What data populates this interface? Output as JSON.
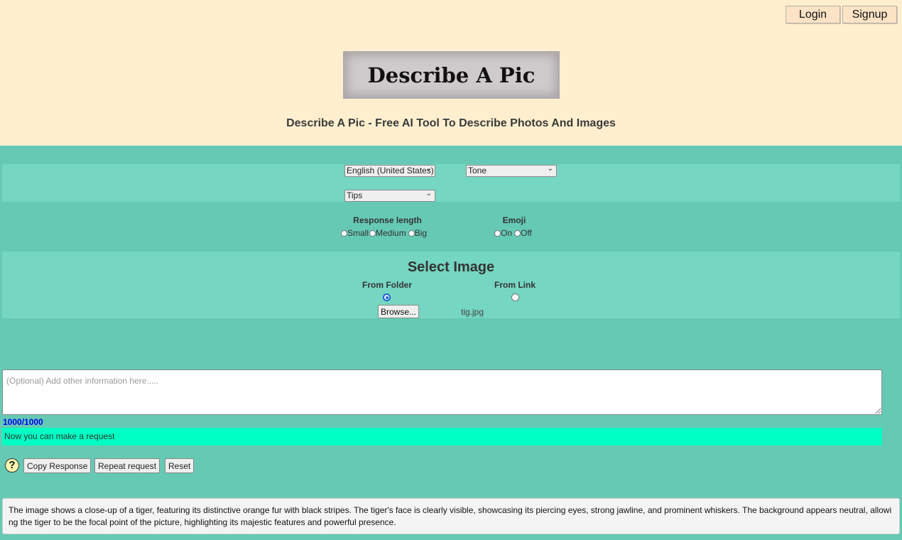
{
  "auth": {
    "login_label": "Login",
    "signup_label": "Signup"
  },
  "logo": {
    "text": "Describe A Pic"
  },
  "subtitle": "Describe A Pic - Free AI Tool To Describe Photos And Images",
  "options": {
    "language": "English (United States)",
    "tone": "Tone",
    "tips": "Tips"
  },
  "response_length": {
    "title": "Response length",
    "options": [
      "Small",
      "Medium",
      "Big"
    ]
  },
  "emoji": {
    "title": "Emoji",
    "options": [
      "On",
      "Off"
    ]
  },
  "select_image": {
    "title": "Select Image",
    "from_folder": "From Folder",
    "from_link": "From Link",
    "selected": "From Folder",
    "browse_label": "Browse...",
    "filename": "tig.jpg"
  },
  "info": {
    "placeholder": "(Optional) Add other information here.....",
    "value": "",
    "counter": "1000/1000"
  },
  "status": "Now you can make a request",
  "actions": {
    "help": "?",
    "copy_label": "Copy Response",
    "repeat_label": "Repeat request",
    "reset_label": "Reset"
  },
  "response_text": "The image shows a close-up of a tiger, featuring its distinctive orange fur with black stripes. The tiger's face is clearly visible, showcasing its piercing eyes, strong jawline, and prominent whiskers. The background appears neutral, allowing the tiger to be the focal point of the picture, highlighting its majestic features and powerful presence."
}
